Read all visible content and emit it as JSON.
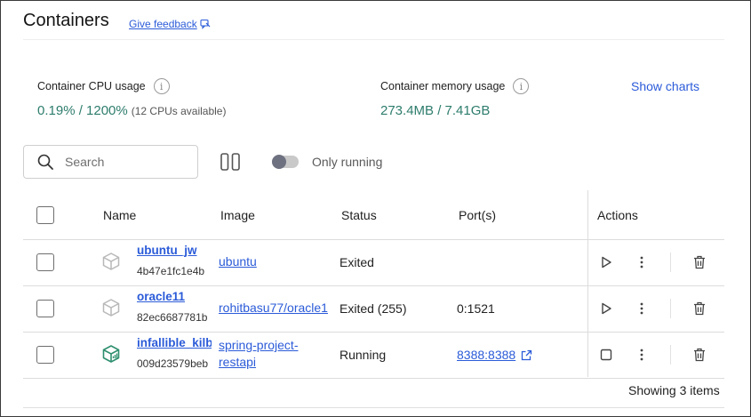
{
  "header": {
    "title": "Containers",
    "feedback_label": "Give feedback"
  },
  "stats": {
    "cpu_label": "Container CPU usage",
    "cpu_value": "0.19% / 1200%",
    "cpu_note": "(12 CPUs available)",
    "memory_label": "Container memory usage",
    "memory_value": "273.4MB / 7.41GB",
    "show_charts_label": "Show charts"
  },
  "toolbar": {
    "search_placeholder": "Search",
    "only_running_label": "Only running",
    "only_running_enabled": false
  },
  "table": {
    "columns": [
      "Name",
      "Image",
      "Status",
      "Port(s)",
      "Actions"
    ],
    "rows": [
      {
        "name": "ubuntu_jw",
        "id": "4b47e1fc1e4b",
        "image": "ubuntu",
        "status": "Exited",
        "port": "",
        "running": false
      },
      {
        "name": "oracle11",
        "id": "82ec6687781b",
        "image": "rohitbasu77/oracle1",
        "status": "Exited (255)",
        "port": "0:1521",
        "running": false
      },
      {
        "name": "infallible_kilb",
        "id": "009d23579beb",
        "image": "spring-project-restapi",
        "image_line1": "spring-project-",
        "image_line2": "restapi",
        "status": "Running",
        "port": "8388:8388",
        "running": true
      }
    ]
  },
  "footer": {
    "showing": "Showing 3 items"
  },
  "colors": {
    "accent": "#2b5bd8",
    "stat_value": "#2e7d6d",
    "running_icon": "#2e8f6f",
    "stopped_icon": "#b8b8b8"
  }
}
